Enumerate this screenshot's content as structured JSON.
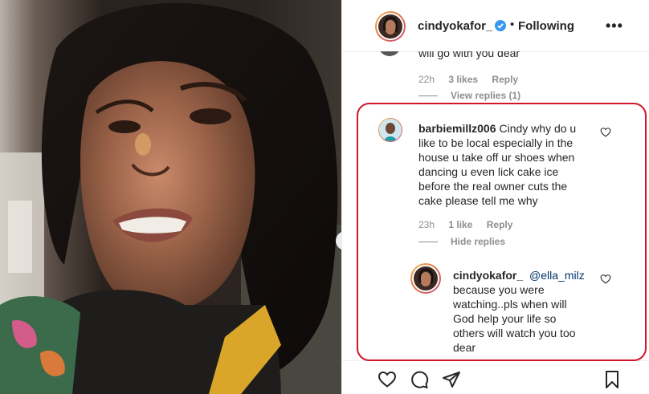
{
  "post": {
    "username": "cindyokafor_",
    "separator": "•",
    "follow_state": "Following",
    "more_label": "•••"
  },
  "prev_comment": {
    "cut_text": "will go with you dear",
    "time": "22h",
    "likes": "3 likes",
    "reply": "Reply",
    "view_replies": "View replies (1)"
  },
  "comment": {
    "author": "barbiemillz006",
    "text": "Cindy why do u like to be local especially in the house u take off ur shoes when dancing u even lick cake ice before the real owner cuts the cake please tell me why",
    "lines": [
      "Cindy why do u",
      "like to be local especially in the",
      "house u take off ur shoes when",
      "dancing u even lick cake ice",
      "before the real owner cuts the",
      "cake please tell me why"
    ],
    "time": "23h",
    "likes": "1 like",
    "reply": "Reply",
    "hide_replies": "Hide replies"
  },
  "reply": {
    "author": "cindyokafor_",
    "mention": "@ella_milz",
    "lines": [
      "because you were",
      "watching..pls when will",
      "God help your life so",
      "others will watch you too",
      "dear"
    ]
  },
  "icons": {
    "verified": "verified-badge-icon",
    "like": "heart-icon",
    "comment": "comment-icon",
    "share": "paper-plane-icon",
    "save": "bookmark-icon",
    "next": "chevron-right-icon"
  },
  "colors": {
    "verified_blue": "#3897f0",
    "annotation_red": "#d0162a",
    "mention_blue": "#00376b",
    "muted_gray": "#8e8e8e"
  }
}
